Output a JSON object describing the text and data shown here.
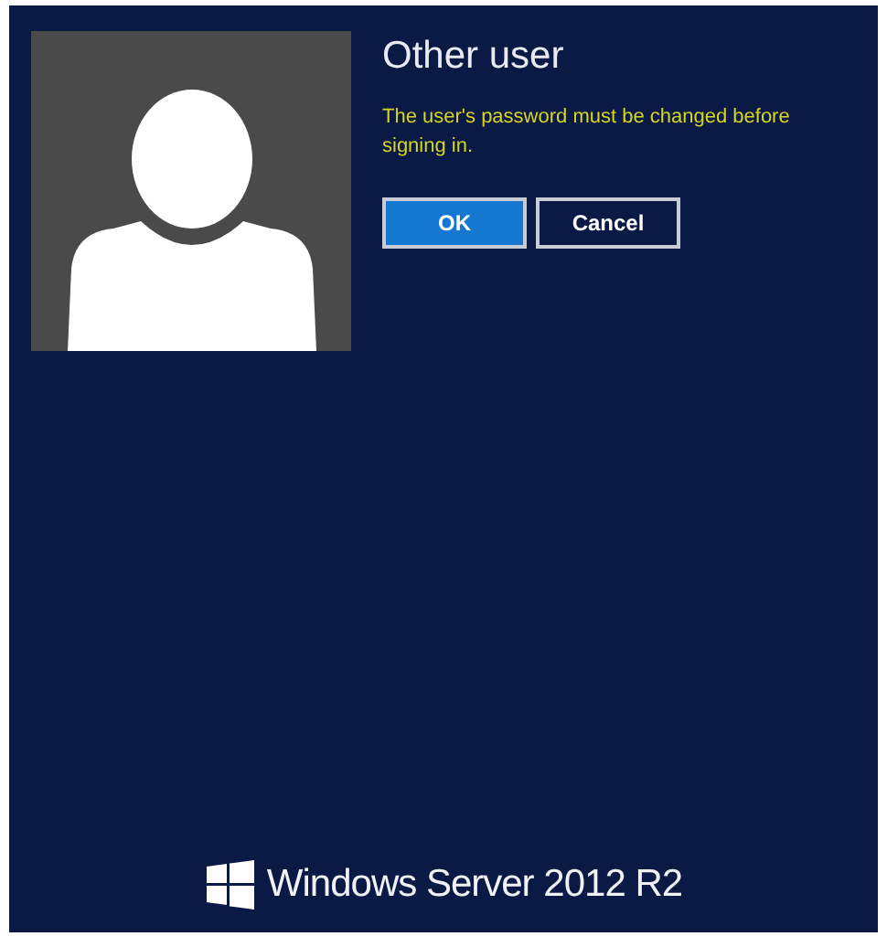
{
  "user": {
    "name": "Other user",
    "message": "The user's password must be changed before signing in."
  },
  "buttons": [
    {
      "label": "OK",
      "primary": true
    },
    {
      "label": "Cancel",
      "primary": false
    }
  ],
  "branding": {
    "product": "Windows Server",
    "version": "2012 R2"
  }
}
